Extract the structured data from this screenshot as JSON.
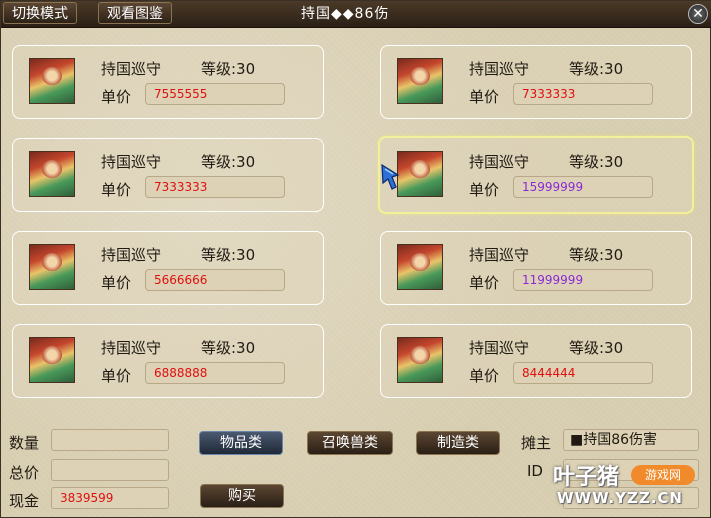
{
  "header": {
    "switch_mode": "切换模式",
    "view_album": "观看图鉴",
    "title": "持国◆◆86伤",
    "close": "✕"
  },
  "item_name": "持国巡守",
  "level_label": "等级:30",
  "price_label": "单价",
  "items": [
    {
      "price": "7555555",
      "price_color": "red"
    },
    {
      "price": "7333333",
      "price_color": "red"
    },
    {
      "price": "7333333",
      "price_color": "red"
    },
    {
      "price": "15999999",
      "price_color": "purple"
    },
    {
      "price": "5666666",
      "price_color": "red"
    },
    {
      "price": "11999999",
      "price_color": "purple"
    },
    {
      "price": "6888888",
      "price_color": "red"
    },
    {
      "price": "8444444",
      "price_color": "red"
    }
  ],
  "footer": {
    "quantity_label": "数量",
    "quantity_value": "",
    "total_label": "总价",
    "total_value": "",
    "cash_label": "现金",
    "cash_value": "3839599",
    "tab_items": "物品类",
    "tab_pets": "召唤兽类",
    "tab_craft": "制造类",
    "buy": "购买",
    "stall_owner_label": "摊主",
    "stall_owner_value": "■持国86伤害",
    "id_label": "ID"
  },
  "watermark": {
    "brand": "叶子猪",
    "sub": "游戏网",
    "url": "WWW.YZZ.CN"
  },
  "colors": {
    "red": "#e01010",
    "purple": "#8a28d8",
    "selected_border": "#f3f09a"
  }
}
